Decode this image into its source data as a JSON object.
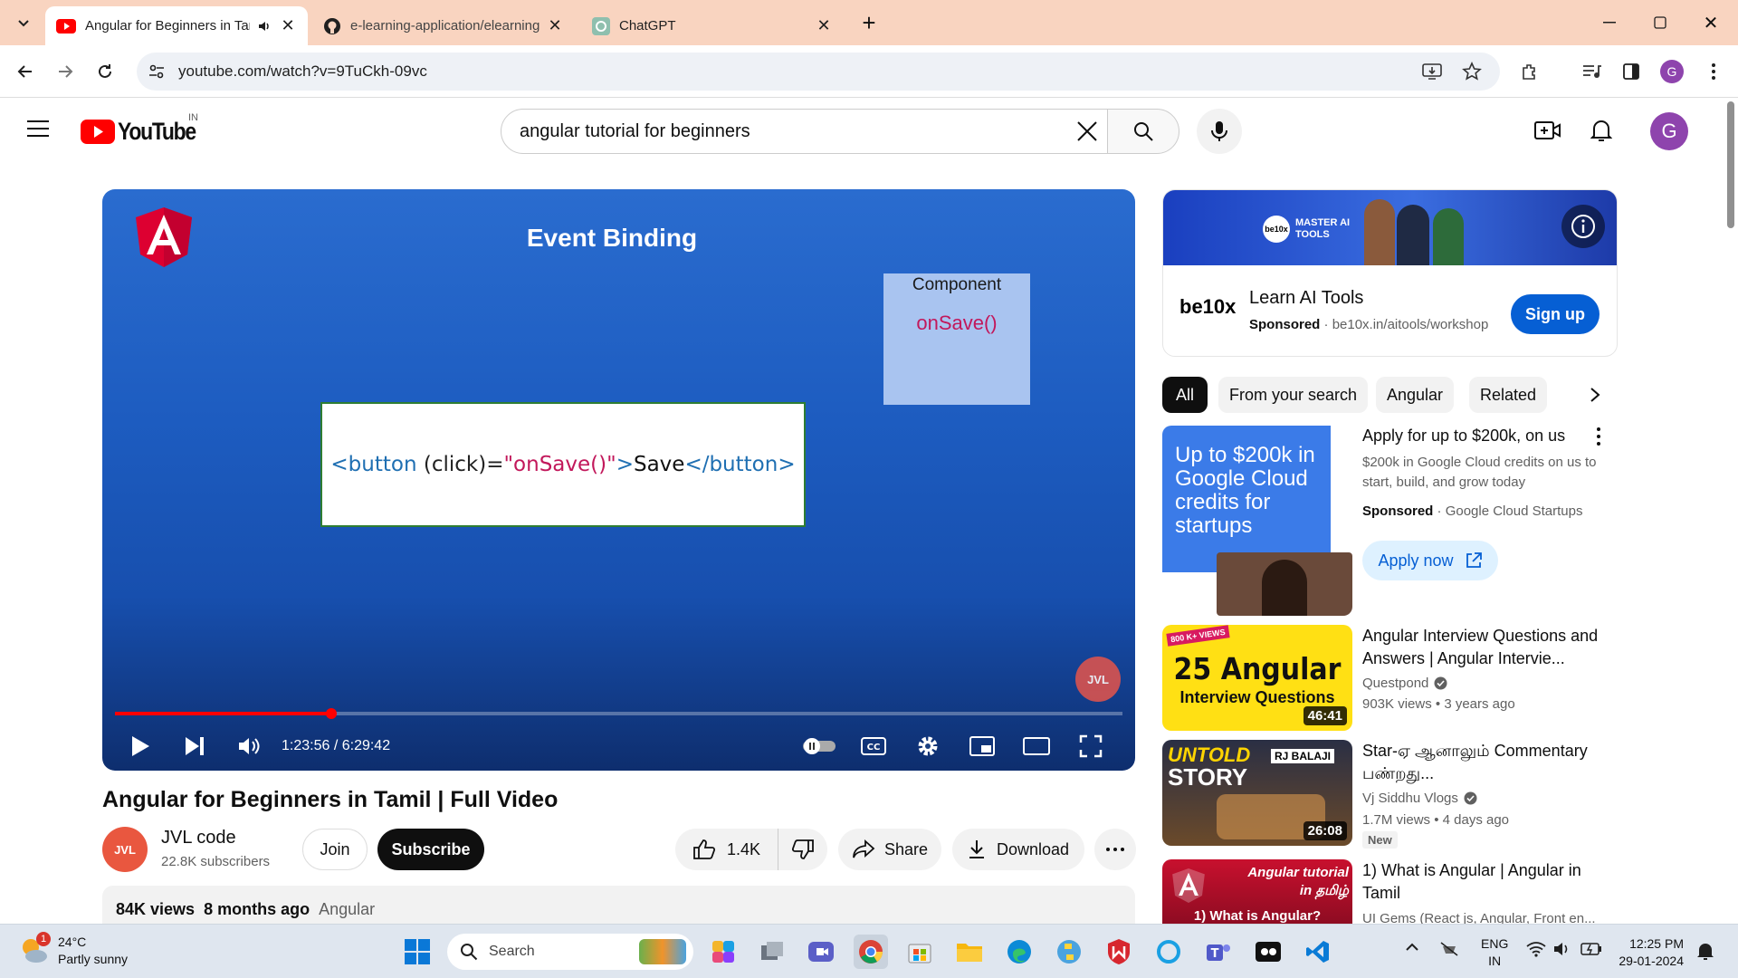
{
  "browser": {
    "tabs": [
      {
        "title": "Angular for Beginners in Tamil | Full Video - YouTube",
        "active": true
      },
      {
        "title": "e-learning-application/elearning",
        "active": false
      },
      {
        "title": "ChatGPT",
        "active": false
      }
    ],
    "url": "youtube.com/watch?v=9TuCkh-09vc",
    "profile_initial": "G"
  },
  "youtube": {
    "logo_text": "YouTube",
    "region": "IN",
    "search_value": "angular tutorial for beginners",
    "avatar_initial": "G"
  },
  "player": {
    "slide_title": "Event Binding",
    "component_label": "Component",
    "component_fn": "onSave()",
    "code": {
      "open": "<button",
      "attr": "(click)=",
      "value": "\"onSave()\"",
      "close_open": ">",
      "text": "Save",
      "end_tag": "</button>"
    },
    "time": "1:23:56 / 6:29:42",
    "progress_fraction": 0.215,
    "watermark": "JVL"
  },
  "video": {
    "title": "Angular for Beginners in Tamil | Full Video",
    "channel": "JVL code",
    "subscribers": "22.8K subscribers",
    "channel_avatar_text": "JVL",
    "join": "Join",
    "subscribe": "Subscribe",
    "likes": "1.4K",
    "share": "Share",
    "download": "Download",
    "views": "84K views",
    "age": "8 months ago",
    "tag": "Angular"
  },
  "ad": {
    "banner_text": "MASTER AI TOOLS",
    "brand": "be10x",
    "title": "Learn AI Tools",
    "sponsored": "Sponsored",
    "domain": "be10x.in/aitools/workshop",
    "cta": "Sign up"
  },
  "chips": [
    "All",
    "From your search",
    "Angular",
    "Related"
  ],
  "promo": {
    "thumb_text": "Up to $200k in Google Cloud credits for startups",
    "title": "Apply for up to $200k, on us",
    "desc": "$200k in Google Cloud credits on us to start, build, and grow today",
    "sponsored": "Sponsored",
    "advertiser": "Google Cloud Startups",
    "cta": "Apply now"
  },
  "related": [
    {
      "title": "Angular Interview Questions and Answers | Angular Intervie...",
      "channel": "Questpond",
      "stats": "903K views",
      "age": "3 years ago",
      "duration": "46:41",
      "thumb_line1": "25 Angular",
      "thumb_line2": "Interview Questions",
      "badge": "800 K+ VIEWS"
    },
    {
      "title": "Star-ஏ ஆனாலும் Commentary பண்றது...",
      "channel": "Vj Siddhu Vlogs",
      "stats": "1.7M views",
      "age": "4 days ago",
      "duration": "26:08",
      "new": "New",
      "thumb_line1": "UNTOLD",
      "thumb_line2": "STORY",
      "thumb_tag": "RJ BALAJI"
    },
    {
      "title": "1) What is Angular | Angular in Tamil",
      "channel": "UI Gems (React js, Angular, Front en...",
      "thumb_line1": "Angular tutorial",
      "thumb_line2": "in தமிழ்",
      "thumb_line3": "1) What is Angular?"
    }
  ],
  "taskbar": {
    "temp": "24°C",
    "weather": "Partly sunny",
    "weather_badge": "1",
    "search": "Search",
    "lang1": "ENG",
    "lang2": "IN",
    "time": "12:25 PM",
    "date": "29-01-2024"
  },
  "colors": {
    "youtube_red": "#ff0000",
    "subscribe_bg": "#0f0f0f",
    "signup_blue": "#065fd4",
    "tabstrip": "#f9d4c0"
  }
}
